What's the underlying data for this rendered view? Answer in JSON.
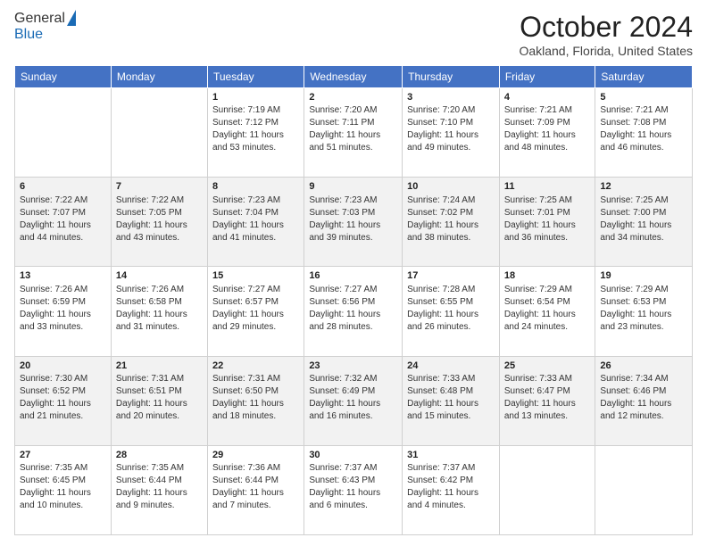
{
  "logo": {
    "general": "General",
    "blue": "Blue"
  },
  "header": {
    "month": "October 2024",
    "location": "Oakland, Florida, United States"
  },
  "weekdays": [
    "Sunday",
    "Monday",
    "Tuesday",
    "Wednesday",
    "Thursday",
    "Friday",
    "Saturday"
  ],
  "weeks": [
    [
      {
        "day": "",
        "info": ""
      },
      {
        "day": "",
        "info": ""
      },
      {
        "day": "1",
        "info": "Sunrise: 7:19 AM\nSunset: 7:12 PM\nDaylight: 11 hours and 53 minutes."
      },
      {
        "day": "2",
        "info": "Sunrise: 7:20 AM\nSunset: 7:11 PM\nDaylight: 11 hours and 51 minutes."
      },
      {
        "day": "3",
        "info": "Sunrise: 7:20 AM\nSunset: 7:10 PM\nDaylight: 11 hours and 49 minutes."
      },
      {
        "day": "4",
        "info": "Sunrise: 7:21 AM\nSunset: 7:09 PM\nDaylight: 11 hours and 48 minutes."
      },
      {
        "day": "5",
        "info": "Sunrise: 7:21 AM\nSunset: 7:08 PM\nDaylight: 11 hours and 46 minutes."
      }
    ],
    [
      {
        "day": "6",
        "info": "Sunrise: 7:22 AM\nSunset: 7:07 PM\nDaylight: 11 hours and 44 minutes."
      },
      {
        "day": "7",
        "info": "Sunrise: 7:22 AM\nSunset: 7:05 PM\nDaylight: 11 hours and 43 minutes."
      },
      {
        "day": "8",
        "info": "Sunrise: 7:23 AM\nSunset: 7:04 PM\nDaylight: 11 hours and 41 minutes."
      },
      {
        "day": "9",
        "info": "Sunrise: 7:23 AM\nSunset: 7:03 PM\nDaylight: 11 hours and 39 minutes."
      },
      {
        "day": "10",
        "info": "Sunrise: 7:24 AM\nSunset: 7:02 PM\nDaylight: 11 hours and 38 minutes."
      },
      {
        "day": "11",
        "info": "Sunrise: 7:25 AM\nSunset: 7:01 PM\nDaylight: 11 hours and 36 minutes."
      },
      {
        "day": "12",
        "info": "Sunrise: 7:25 AM\nSunset: 7:00 PM\nDaylight: 11 hours and 34 minutes."
      }
    ],
    [
      {
        "day": "13",
        "info": "Sunrise: 7:26 AM\nSunset: 6:59 PM\nDaylight: 11 hours and 33 minutes."
      },
      {
        "day": "14",
        "info": "Sunrise: 7:26 AM\nSunset: 6:58 PM\nDaylight: 11 hours and 31 minutes."
      },
      {
        "day": "15",
        "info": "Sunrise: 7:27 AM\nSunset: 6:57 PM\nDaylight: 11 hours and 29 minutes."
      },
      {
        "day": "16",
        "info": "Sunrise: 7:27 AM\nSunset: 6:56 PM\nDaylight: 11 hours and 28 minutes."
      },
      {
        "day": "17",
        "info": "Sunrise: 7:28 AM\nSunset: 6:55 PM\nDaylight: 11 hours and 26 minutes."
      },
      {
        "day": "18",
        "info": "Sunrise: 7:29 AM\nSunset: 6:54 PM\nDaylight: 11 hours and 24 minutes."
      },
      {
        "day": "19",
        "info": "Sunrise: 7:29 AM\nSunset: 6:53 PM\nDaylight: 11 hours and 23 minutes."
      }
    ],
    [
      {
        "day": "20",
        "info": "Sunrise: 7:30 AM\nSunset: 6:52 PM\nDaylight: 11 hours and 21 minutes."
      },
      {
        "day": "21",
        "info": "Sunrise: 7:31 AM\nSunset: 6:51 PM\nDaylight: 11 hours and 20 minutes."
      },
      {
        "day": "22",
        "info": "Sunrise: 7:31 AM\nSunset: 6:50 PM\nDaylight: 11 hours and 18 minutes."
      },
      {
        "day": "23",
        "info": "Sunrise: 7:32 AM\nSunset: 6:49 PM\nDaylight: 11 hours and 16 minutes."
      },
      {
        "day": "24",
        "info": "Sunrise: 7:33 AM\nSunset: 6:48 PM\nDaylight: 11 hours and 15 minutes."
      },
      {
        "day": "25",
        "info": "Sunrise: 7:33 AM\nSunset: 6:47 PM\nDaylight: 11 hours and 13 minutes."
      },
      {
        "day": "26",
        "info": "Sunrise: 7:34 AM\nSunset: 6:46 PM\nDaylight: 11 hours and 12 minutes."
      }
    ],
    [
      {
        "day": "27",
        "info": "Sunrise: 7:35 AM\nSunset: 6:45 PM\nDaylight: 11 hours and 10 minutes."
      },
      {
        "day": "28",
        "info": "Sunrise: 7:35 AM\nSunset: 6:44 PM\nDaylight: 11 hours and 9 minutes."
      },
      {
        "day": "29",
        "info": "Sunrise: 7:36 AM\nSunset: 6:44 PM\nDaylight: 11 hours and 7 minutes."
      },
      {
        "day": "30",
        "info": "Sunrise: 7:37 AM\nSunset: 6:43 PM\nDaylight: 11 hours and 6 minutes."
      },
      {
        "day": "31",
        "info": "Sunrise: 7:37 AM\nSunset: 6:42 PM\nDaylight: 11 hours and 4 minutes."
      },
      {
        "day": "",
        "info": ""
      },
      {
        "day": "",
        "info": ""
      }
    ]
  ]
}
